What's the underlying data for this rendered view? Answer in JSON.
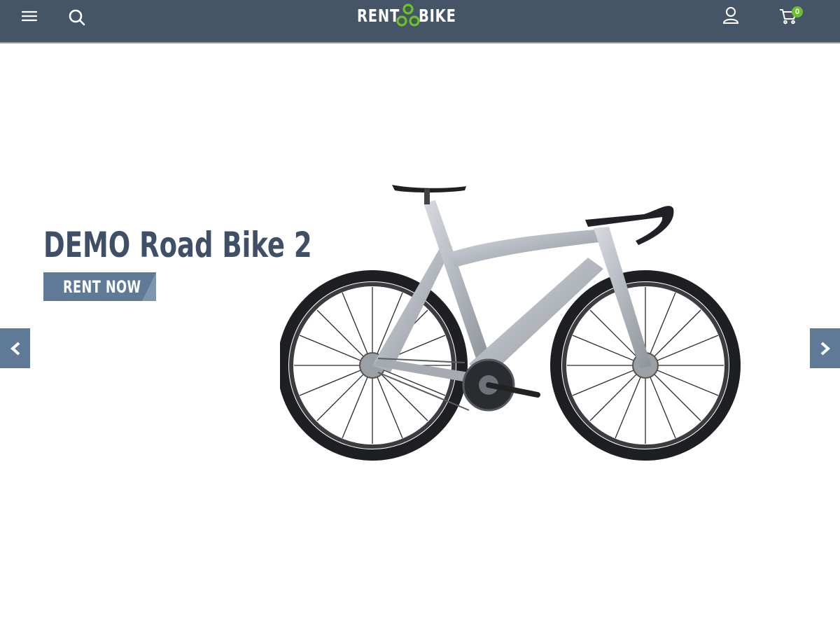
{
  "header": {
    "logo_left": "RENT",
    "logo_right": "BIKE",
    "cart_count": "0",
    "icons": [
      "hamburger-menu-icon",
      "search-icon",
      "user-icon",
      "cart-icon"
    ]
  },
  "hero": {
    "title": "DEMO Road Bike 2",
    "cta_label": "RENT NOW",
    "prev_icon": "chevron-left-icon",
    "next_icon": "chevron-right-icon",
    "image": "road-bike-image"
  },
  "colors": {
    "header_bg": "#455567",
    "accent": "#5f7a96",
    "title": "#3f5066",
    "badge": "#6cbf2d"
  }
}
